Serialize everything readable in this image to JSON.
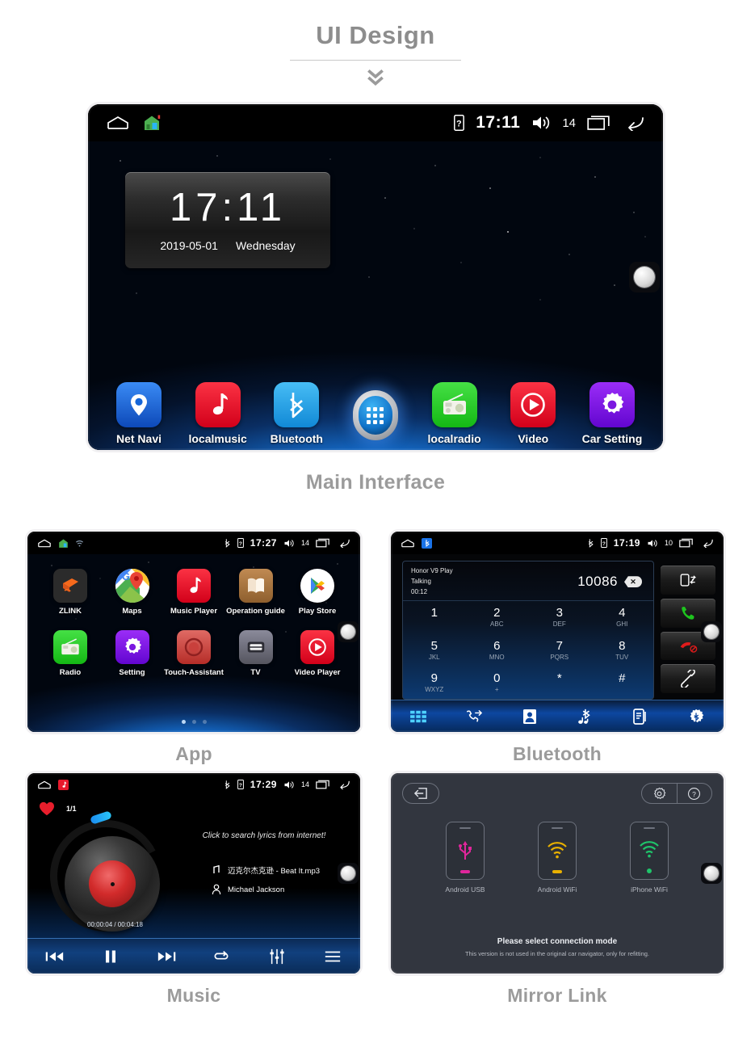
{
  "page": {
    "title": "UI Design",
    "chevron_icon": "double-chevron-down-icon"
  },
  "main_screen": {
    "caption": "Main Interface",
    "statusbar": {
      "home_icon": "home-outline-icon",
      "house_icon": "house-launcher-icon",
      "sim_icon": "sim-card-icon",
      "time": "17:11",
      "volume_icon": "volume-icon",
      "volume_level": "14",
      "recents_icon": "recents-icon",
      "back_icon": "back-arrow-icon"
    },
    "clock_widget": {
      "time": "17:11",
      "date": "2019-05-01",
      "weekday": "Wednesday"
    },
    "dock": [
      {
        "label": "Net Navi",
        "icon": "map-pin-icon",
        "color": "#1565d8"
      },
      {
        "label": "localmusic",
        "icon": "music-note-icon",
        "color": "#e8192c"
      },
      {
        "label": "Bluetooth",
        "icon": "bluetooth-icon",
        "color": "#29a8ea"
      },
      {
        "label": "",
        "icon": "app-drawer-icon",
        "color": ""
      },
      {
        "label": "localradio",
        "icon": "radio-icon",
        "color": "#2ecc2e"
      },
      {
        "label": "Video",
        "icon": "play-circle-icon",
        "color": "#e8192c"
      },
      {
        "label": "Car Setting",
        "icon": "gear-icon",
        "color": "#7b18e0"
      }
    ],
    "knob_icon": "rotary-knob-icon"
  },
  "app_screen": {
    "caption": "App",
    "statusbar": {
      "home_icon": "home-outline-icon",
      "house_icon": "house-launcher-icon",
      "wifi_icon": "wifi-icon",
      "bluetooth_icon": "bluetooth-icon",
      "sim_icon": "sim-card-icon",
      "time": "17:27",
      "volume_icon": "volume-icon",
      "volume_level": "14",
      "recents_icon": "recents-icon",
      "back_icon": "back-arrow-icon"
    },
    "apps_row1": [
      {
        "label": "ZLINK",
        "icon": "zlink-icon",
        "color": "#2b2b2b"
      },
      {
        "label": "Maps",
        "icon": "google-maps-icon",
        "color": "#ffffff"
      },
      {
        "label": "Music Player",
        "icon": "music-note-icon",
        "color": "#e8192c"
      },
      {
        "label": "Operation guide",
        "icon": "book-guide-icon",
        "color": "#a8743f"
      },
      {
        "label": "Play Store",
        "icon": "play-store-icon",
        "color": "#ffffff"
      }
    ],
    "apps_row2": [
      {
        "label": "Radio",
        "icon": "radio-icon",
        "color": "#2ecc2e"
      },
      {
        "label": "Setting",
        "icon": "gear-icon",
        "color": "#7b18e0"
      },
      {
        "label": "Touch-Assistant",
        "icon": "touch-assistant-icon",
        "color": "#c9403c"
      },
      {
        "label": "TV",
        "icon": "tv-icon",
        "color": "#6b6b7a"
      },
      {
        "label": "Video Player",
        "icon": "play-circle-icon",
        "color": "#e8192c"
      }
    ],
    "page_dots": 3,
    "active_dot": 0
  },
  "bluetooth_screen": {
    "caption": "Bluetooth",
    "statusbar": {
      "home_icon": "home-outline-icon",
      "bluetooth_app_icon": "bluetooth-app-icon",
      "bluetooth_icon": "bluetooth-icon",
      "sim_icon": "sim-card-icon",
      "time": "17:19",
      "volume_icon": "volume-icon",
      "volume_level": "10",
      "recents_icon": "recents-icon",
      "back_icon": "back-arrow-icon"
    },
    "call": {
      "device_name": "Honor V9 Play",
      "status": "Talking",
      "duration": "00:12",
      "number": "10086",
      "delete_icon": "backspace-icon"
    },
    "keypad": [
      {
        "num": "1",
        "sub": ""
      },
      {
        "num": "2",
        "sub": "ABC"
      },
      {
        "num": "3",
        "sub": "DEF"
      },
      {
        "num": "4",
        "sub": "GHI"
      },
      {
        "num": "5",
        "sub": "JKL"
      },
      {
        "num": "6",
        "sub": "MNO"
      },
      {
        "num": "7",
        "sub": "PQRS"
      },
      {
        "num": "8",
        "sub": "TUV"
      },
      {
        "num": "9",
        "sub": "WXYZ"
      },
      {
        "num": "0",
        "sub": "+"
      },
      {
        "num": "*",
        "sub": ""
      },
      {
        "num": "#",
        "sub": ""
      }
    ],
    "side_buttons": [
      {
        "icon": "transfer-audio-icon"
      },
      {
        "icon": "answer-call-icon"
      },
      {
        "icon": "end-call-icon"
      },
      {
        "icon": "pair-link-icon"
      }
    ],
    "tabs": [
      {
        "icon": "dialpad-icon",
        "active": true
      },
      {
        "icon": "call-history-icon",
        "active": false
      },
      {
        "icon": "contacts-icon",
        "active": false
      },
      {
        "icon": "bluetooth-music-icon",
        "active": false
      },
      {
        "icon": "phonebook-sync-icon",
        "active": false
      },
      {
        "icon": "bluetooth-settings-icon",
        "active": false
      }
    ]
  },
  "music_screen": {
    "caption": "Music",
    "statusbar": {
      "home_icon": "home-outline-icon",
      "music_app_icon": "music-app-icon",
      "bluetooth_icon": "bluetooth-icon",
      "sim_icon": "sim-card-icon",
      "time": "17:29",
      "volume_icon": "volume-icon",
      "volume_level": "14",
      "recents_icon": "recents-icon",
      "back_icon": "back-arrow-icon"
    },
    "favorite_icon": "heart-icon",
    "track_count": "1/1",
    "lyrics_hint": "Click to search lyrics from internet!",
    "track_title": "迈克尔杰克逊 - Beat It.mp3",
    "artist": "Michael Jackson",
    "elapsed": "00:00:04",
    "total": "00:04:18",
    "time_display": "00:00:04 / 00:04:18",
    "controls": [
      {
        "icon": "previous-track-icon"
      },
      {
        "icon": "pause-icon"
      },
      {
        "icon": "next-track-icon"
      },
      {
        "icon": "repeat-icon"
      },
      {
        "icon": "equalizer-icon"
      },
      {
        "icon": "playlist-icon"
      }
    ]
  },
  "mirror_screen": {
    "caption": "Mirror Link",
    "exit_icon": "exit-icon",
    "settings_icon": "gear-icon",
    "help_icon": "question-circle-icon",
    "modes": [
      {
        "label": "Android USB",
        "icon": "usb-icon",
        "color": "#e0269b"
      },
      {
        "label": "Android WiFi",
        "icon": "wifi-icon",
        "color": "#e8b000"
      },
      {
        "label": "iPhone WiFi",
        "icon": "wifi-icon",
        "color": "#1fc46a"
      }
    ],
    "prompt": "Please select connection mode",
    "note": "This version is not used in the original car navigator, only for refitting."
  },
  "colors": {
    "page_bg": "#ffffff",
    "caption_gray": "#9b9b9b",
    "accent_blue": "#1468c4",
    "mirror_bg": "#32363f"
  }
}
